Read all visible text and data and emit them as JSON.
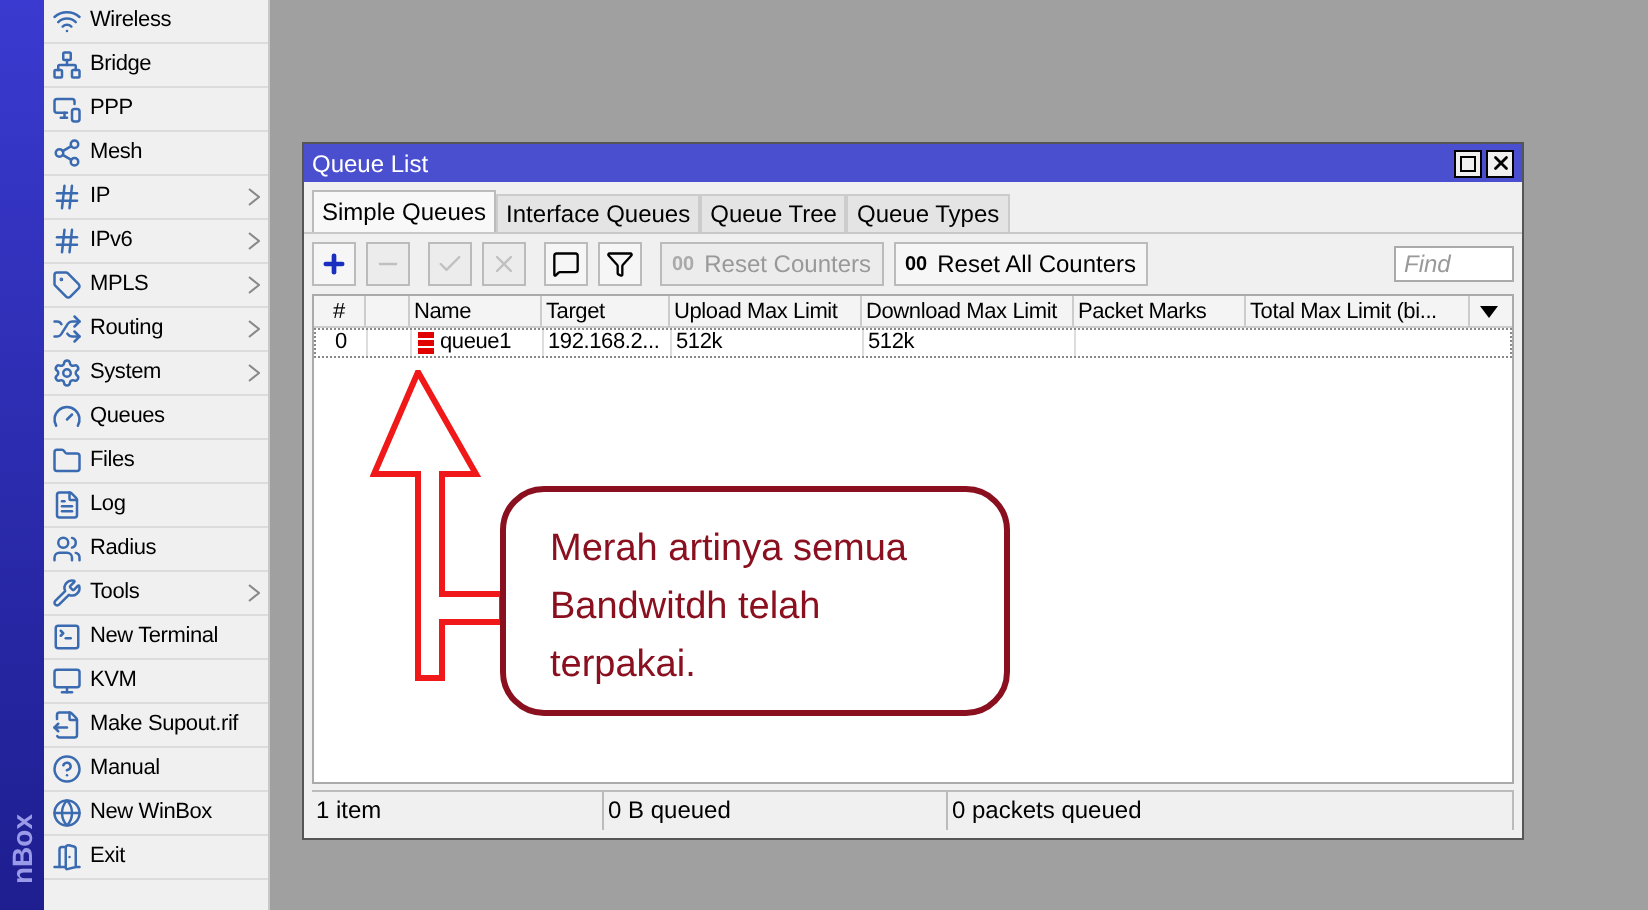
{
  "sidebar": {
    "brand": "nBox",
    "items": [
      {
        "label": "Wireless",
        "submenu": false
      },
      {
        "label": "Bridge",
        "submenu": false
      },
      {
        "label": "PPP",
        "submenu": false
      },
      {
        "label": "Mesh",
        "submenu": false
      },
      {
        "label": "IP",
        "submenu": true
      },
      {
        "label": "IPv6",
        "submenu": true
      },
      {
        "label": "MPLS",
        "submenu": true
      },
      {
        "label": "Routing",
        "submenu": true
      },
      {
        "label": "System",
        "submenu": true
      },
      {
        "label": "Queues",
        "submenu": false
      },
      {
        "label": "Files",
        "submenu": false
      },
      {
        "label": "Log",
        "submenu": false
      },
      {
        "label": "Radius",
        "submenu": false
      },
      {
        "label": "Tools",
        "submenu": true
      },
      {
        "label": "New Terminal",
        "submenu": false
      },
      {
        "label": "KVM",
        "submenu": false
      },
      {
        "label": "Make Supout.rif",
        "submenu": false
      },
      {
        "label": "Manual",
        "submenu": false
      },
      {
        "label": "New WinBox",
        "submenu": false
      },
      {
        "label": "Exit",
        "submenu": false
      }
    ]
  },
  "window": {
    "title": "Queue List",
    "tabs": [
      {
        "label": "Simple Queues",
        "selected": true
      },
      {
        "label": "Interface Queues",
        "selected": false
      },
      {
        "label": "Queue Tree",
        "selected": false
      },
      {
        "label": "Queue Types",
        "selected": false
      }
    ],
    "toolbar": {
      "icon_buttons": [
        {
          "kind": "add",
          "disabled": false
        },
        {
          "kind": "remove",
          "disabled": true
        },
        {
          "kind": "enable",
          "disabled": true
        },
        {
          "kind": "disable",
          "disabled": true
        },
        {
          "kind": "comment",
          "disabled": false
        },
        {
          "kind": "filter",
          "disabled": false
        }
      ],
      "text_buttons": [
        {
          "icon": "00",
          "label": "Reset Counters",
          "disabled": true
        },
        {
          "icon": "00",
          "label": "Reset All Counters",
          "disabled": false
        }
      ],
      "search": {
        "placeholder": "Find"
      }
    },
    "table": {
      "columns": [
        "#",
        "Name",
        "Target",
        "Upload Max Limit",
        "Download Max Limit",
        "Packet Marks",
        "Total Max Limit (bi..."
      ],
      "rows": [
        {
          "number": "0",
          "name": "queue1",
          "color": "#e00000",
          "target": "192.168.2...",
          "upload": "512k",
          "download": "512k"
        }
      ]
    },
    "status_bar": [
      "1 item",
      "0 B queued",
      "0 packets queued"
    ]
  },
  "callout": {
    "text": "Merah artinya semua Bandwitdh telah terpakai."
  }
}
